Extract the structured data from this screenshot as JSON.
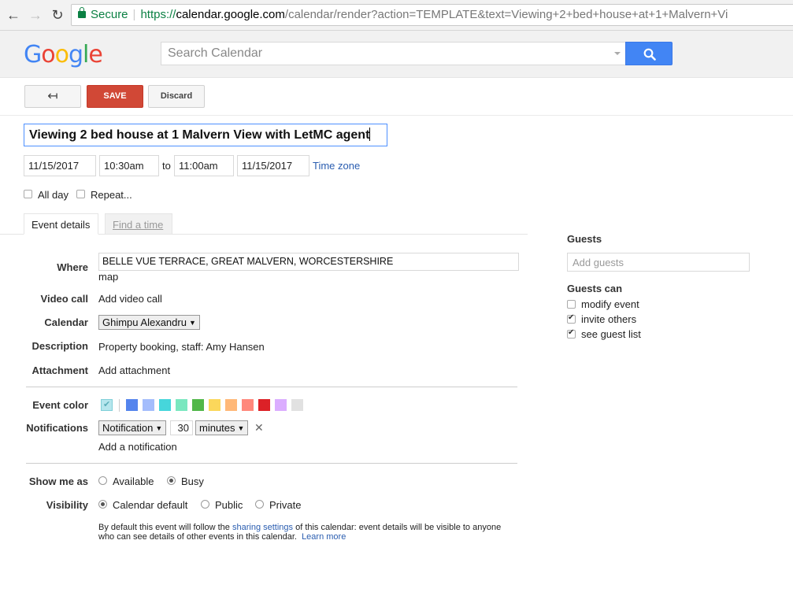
{
  "browser": {
    "secure_label": "Secure",
    "url_scheme": "https://",
    "url_host": "calendar.google.com",
    "url_rest": "/calendar/render?action=TEMPLATE&text=Viewing+2+bed+house+at+1+Malvern+Vi"
  },
  "header": {
    "logo_letters": [
      "G",
      "o",
      "o",
      "g",
      "l",
      "e"
    ],
    "search_placeholder": "Search Calendar"
  },
  "toolbar": {
    "back_label": "↤",
    "save_label": "SAVE",
    "discard_label": "Discard"
  },
  "event": {
    "title": "Viewing 2 bed house at 1 Malvern View with LetMC agent",
    "start_date": "11/15/2017",
    "start_time": "10:30am",
    "to_label": "to",
    "end_time": "11:00am",
    "end_date": "11/15/2017",
    "timezone_link": "Time zone",
    "all_day_label": "All day",
    "all_day_checked": false,
    "repeat_label": "Repeat...",
    "repeat_checked": false
  },
  "tabs": [
    {
      "label": "Event details",
      "active": true
    },
    {
      "label": "Find a time",
      "active": false
    }
  ],
  "details": {
    "where_label": "Where",
    "where_value": "BELLE VUE TERRACE, GREAT MALVERN, WORCESTERSHIRE",
    "map_link": "map",
    "video_label": "Video call",
    "video_link": "Add video call",
    "calendar_label": "Calendar",
    "calendar_value": "Ghimpu Alexandru",
    "description_label": "Description",
    "description_value": "Property booking, staff: Amy Hansen",
    "attachment_label": "Attachment",
    "attachment_link": "Add attachment",
    "color_label": "Event color",
    "colors": [
      "#5484ed",
      "#a4bdfc",
      "#46d6db",
      "#7ae7bf",
      "#51b749",
      "#fbd75b",
      "#ffb878",
      "#ff887c",
      "#dc2127",
      "#dbadff",
      "#e1e1e1"
    ],
    "selected_color": "#b6e6ed",
    "notifications_label": "Notifications",
    "notification_type": "Notification",
    "notification_amount": "30",
    "notification_unit": "minutes",
    "remove_notification": "✕",
    "add_notification_link": "Add a notification",
    "show_me_as_label": "Show me as",
    "show_options": [
      {
        "label": "Available",
        "selected": false
      },
      {
        "label": "Busy",
        "selected": true
      }
    ],
    "visibility_label": "Visibility",
    "visibility_options": [
      {
        "label": "Calendar default",
        "selected": true
      },
      {
        "label": "Public",
        "selected": false
      },
      {
        "label": "Private",
        "selected": false
      }
    ],
    "note_text_1": "By default this event will follow the ",
    "note_link_1": "sharing settings",
    "note_text_2": " of this calendar: event details will be visible to anyone who can see details of other events in this calendar.",
    "note_link_2": "Learn more"
  },
  "guests": {
    "heading": "Guests",
    "add_placeholder": "Add guests",
    "guests_can_heading": "Guests can",
    "permissions": [
      {
        "label": "modify event",
        "checked": false
      },
      {
        "label": "invite others",
        "checked": true
      },
      {
        "label": "see guest list",
        "checked": true
      }
    ]
  }
}
